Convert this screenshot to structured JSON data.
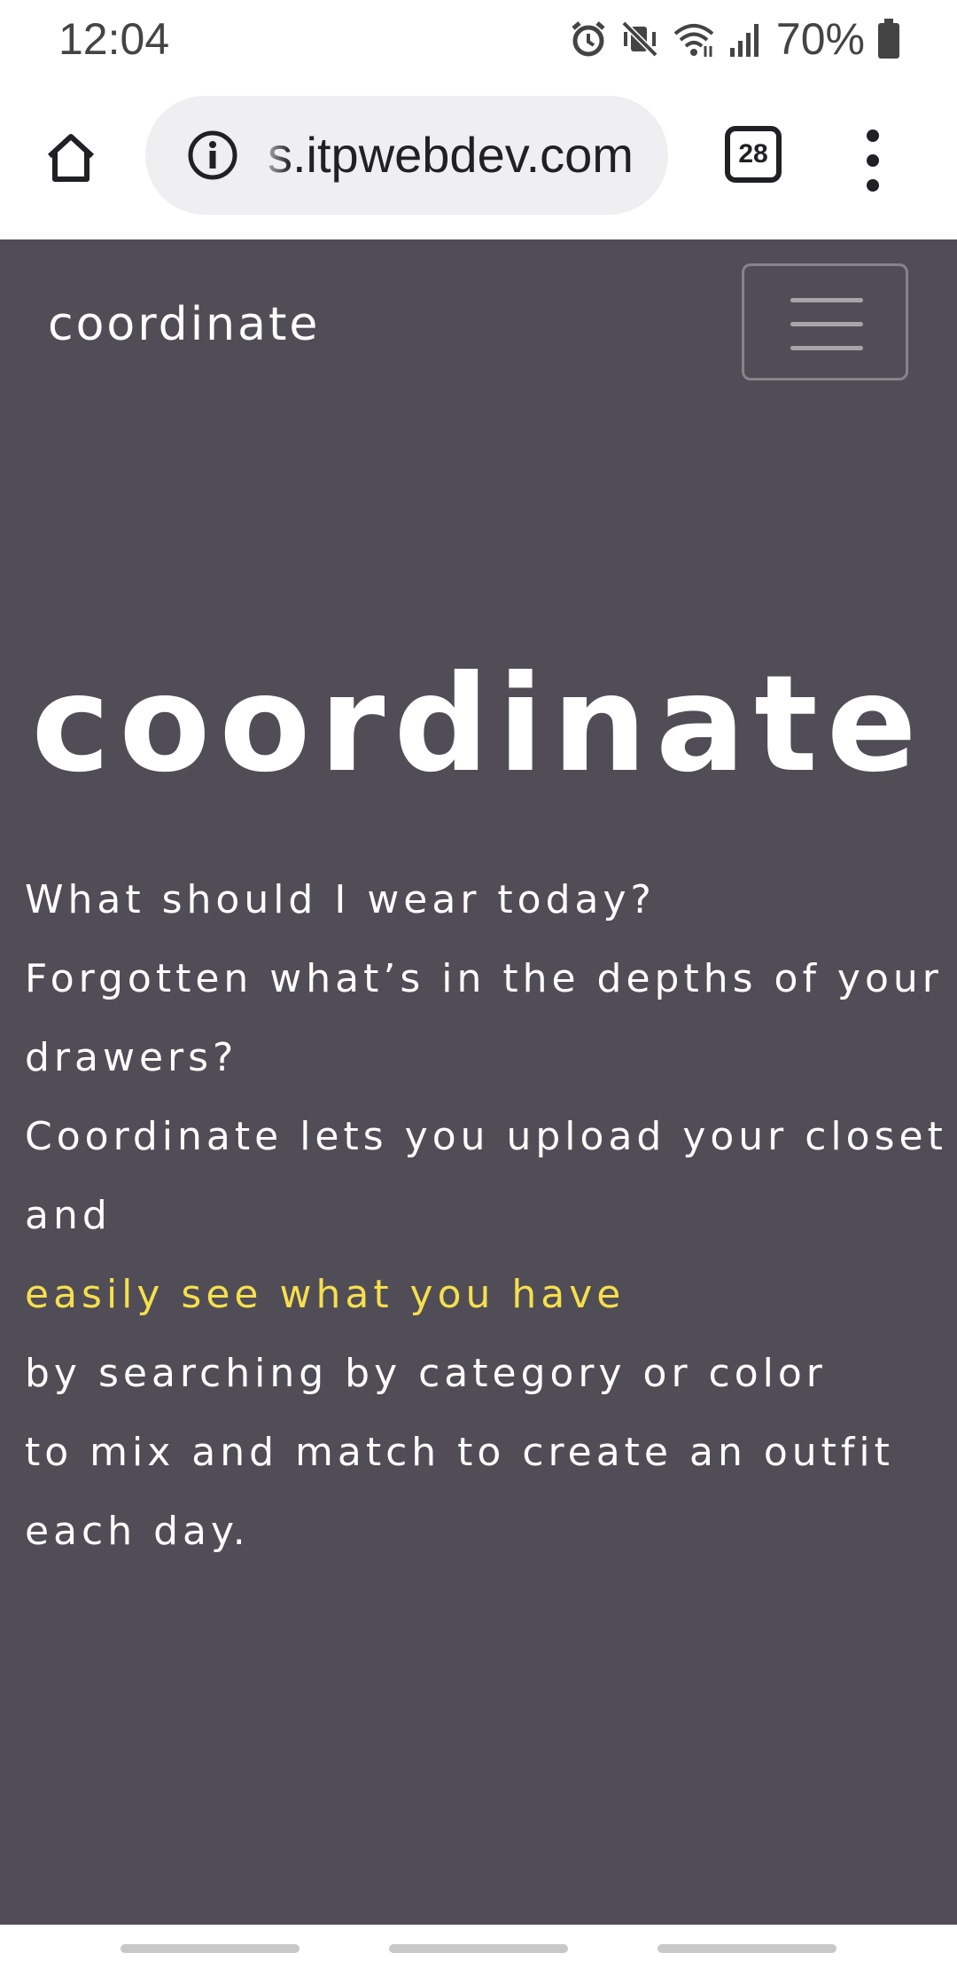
{
  "status_bar": {
    "time": "12:04",
    "battery": "70%",
    "icons": [
      "alarm-icon",
      "vibrate-mute-icon",
      "wifi-icon",
      "signal-icon",
      "battery-icon"
    ]
  },
  "browser": {
    "url": "s.itpwebdev.com",
    "tab_count": "28",
    "icons": [
      "home-icon",
      "info-icon",
      "tabs-icon",
      "more-vert-icon"
    ]
  },
  "navbar": {
    "brand": "coordinate",
    "toggler_icon": "hamburger-icon"
  },
  "hero": {
    "title": "coordinate",
    "lines": [
      "What should I wear today?",
      "Forgotten what’s in the depths of your",
      "drawers?",
      "Coordinate lets you upload your closet",
      "and",
      "easily see what you have",
      "by searching by category or color",
      "to mix and match to create an outfit",
      "each day."
    ]
  },
  "colors": {
    "page_background": "#514d56",
    "highlight": "#f5df4d",
    "text": "#ffffff"
  }
}
